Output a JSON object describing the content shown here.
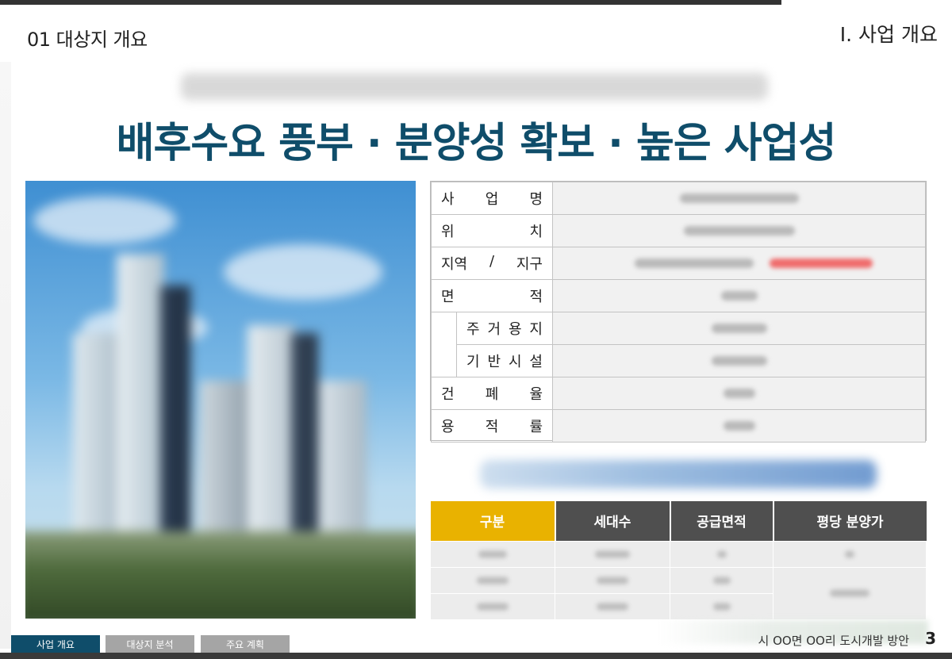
{
  "header": {
    "section": "01 대상지 개요",
    "chapter": "Ⅰ. 사업 개요"
  },
  "headline": "배후수요 풍부 · 분양성 확보 · 높은 사업성",
  "info_table": {
    "rows": [
      {
        "label": [
          "사",
          "업",
          "명"
        ],
        "indent": false
      },
      {
        "label": [
          "위",
          "치"
        ],
        "indent": false
      },
      {
        "label": [
          "지역",
          "/",
          "지구"
        ],
        "indent": false
      },
      {
        "label": [
          "면",
          "적"
        ],
        "indent": false
      },
      {
        "label": [
          "주",
          "거",
          "용",
          "지"
        ],
        "indent": true
      },
      {
        "label": [
          "기",
          "반",
          "시",
          "설"
        ],
        "indent": true
      },
      {
        "label": [
          "건",
          "폐",
          "율"
        ],
        "indent": false
      },
      {
        "label": [
          "용",
          "적",
          "률"
        ],
        "indent": false
      }
    ]
  },
  "supply_table": {
    "headers": [
      "구분",
      "세대수",
      "공급면적",
      "평당 분양가"
    ]
  },
  "footer": {
    "tabs": [
      "사업 개요",
      "대상지 분석",
      "주요 계획"
    ],
    "title": "시 OO면 OO리 도시개발 방안",
    "page": "3"
  },
  "colors": {
    "brand": "#0f4d6a",
    "accent": "#e9b200",
    "header_dark": "#4f4f4f"
  }
}
